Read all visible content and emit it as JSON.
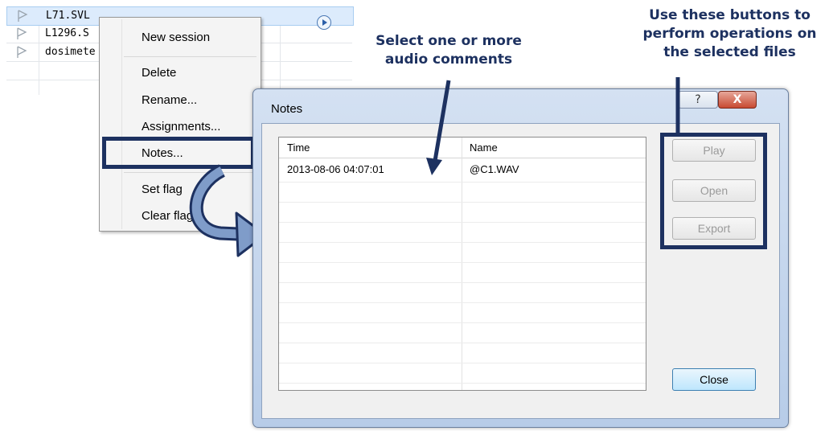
{
  "file_list": {
    "rows": [
      {
        "name": "L71.SVL",
        "selected": true
      },
      {
        "name": "L1296.S",
        "selected": false
      },
      {
        "name": "dosimete",
        "selected": false
      }
    ]
  },
  "context_menu": {
    "items": [
      "New session",
      "Delete",
      "Rename...",
      "Assignments...",
      "Notes...",
      "Set flag",
      "Clear flag"
    ]
  },
  "annotations": {
    "select_caption": "Select one or more\naudio comments",
    "buttons_caption": "Use these buttons to\nperform operations on\nthe selected files"
  },
  "dialog": {
    "title": "Notes",
    "help_label": "?",
    "close_label": "X",
    "columns": [
      "Time",
      "Name"
    ],
    "rows": [
      {
        "time": "2013-08-06 04:07:01",
        "name": "@C1.WAV"
      }
    ],
    "buttons": {
      "play": "Play",
      "open": "Open",
      "export": "Export",
      "close": "Close"
    }
  },
  "colors": {
    "accent": "#1d3160",
    "selection": "#dcebfc"
  }
}
